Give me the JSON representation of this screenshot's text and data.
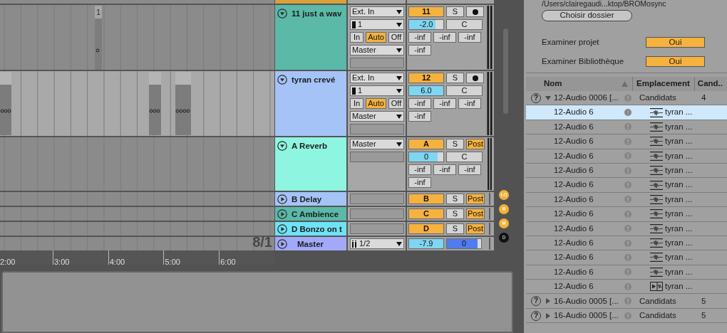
{
  "top_track": {
    "color": "#d7a23b"
  },
  "tracks": [
    {
      "kind": "audio",
      "name": "11 just a wav",
      "color": "#5bb9a8",
      "expanded": true,
      "lane": {
        "kind": "clip",
        "clip_label": "1"
      },
      "input": "Ext. In",
      "input_channel": "1",
      "monitor": [
        {
          "label": "In",
          "selected": false
        },
        {
          "label": "Auto",
          "selected": true
        },
        {
          "label": "Off",
          "selected": false
        }
      ],
      "output": "Master",
      "number": "11",
      "active": true,
      "solo": "S",
      "solo_on": false,
      "armed": false,
      "volume": {
        "text": "-2.0",
        "level": 0.78
      },
      "pan": "C",
      "sends": [
        "-inf",
        "-inf",
        "-inf",
        "-inf"
      ]
    },
    {
      "kind": "audio",
      "name": "tyran crevé",
      "color": "#a5c3f7",
      "expanded": true,
      "lane": {
        "kind": "waveform"
      },
      "input": "Ext. In",
      "input_channel": "1",
      "monitor": [
        {
          "label": "In",
          "selected": false
        },
        {
          "label": "Auto",
          "selected": true
        },
        {
          "label": "Off",
          "selected": false
        }
      ],
      "output": "Master",
      "number": "12",
      "active": true,
      "solo": "S",
      "solo_on": false,
      "armed": false,
      "volume": {
        "text": "6.0",
        "level": 1
      },
      "pan": "C",
      "sends": [
        "-inf",
        "-inf",
        "-inf",
        "-inf"
      ]
    },
    {
      "kind": "return",
      "name": "A Reverb",
      "color": "#8ef5e0",
      "expanded": true,
      "output": "Master",
      "letter": "A",
      "active": true,
      "solo": "S",
      "solo_on": false,
      "post": "Post",
      "post_on": true,
      "volume": {
        "text": "0",
        "level": 0.84
      },
      "pan": "C",
      "sends": [
        "-inf",
        "-inf",
        "-inf",
        "-inf"
      ]
    },
    {
      "kind": "return",
      "name": "B Delay",
      "color": "#a5c3f7",
      "expanded": false,
      "letter": "B",
      "active": true,
      "solo": "S",
      "solo_on": false,
      "post": "Post",
      "post_on": true
    },
    {
      "kind": "return",
      "name": "C Ambience",
      "color": "#5bb9a8",
      "expanded": false,
      "letter": "C",
      "active": true,
      "solo": "S",
      "solo_on": false,
      "post": "Post",
      "post_on": true
    },
    {
      "kind": "return",
      "name": "D Bonzo on t",
      "color": "#6fe3f5",
      "expanded": false,
      "letter": "D",
      "active": true,
      "solo": "S",
      "solo_on": false,
      "post": "Post",
      "post_on": true
    },
    {
      "kind": "master",
      "name": "Master",
      "color": "#a2a9f8",
      "expanded": false,
      "output": "1/2",
      "volume": {
        "text": "-7.9",
        "level": 1
      },
      "pan": {
        "text": "0",
        "level": 0.9
      },
      "position": "8/1"
    }
  ],
  "ruler": [
    "2:00",
    "3:00",
    "4:00",
    "5:00",
    "6:00"
  ],
  "view_buttons": [
    {
      "label": "I-O",
      "on": true
    },
    {
      "label": "R",
      "on": true
    },
    {
      "label": "M",
      "on": true
    },
    {
      "label": "D",
      "on": false
    }
  ],
  "browser": {
    "path": "/Users/clairegaudi...ktop/BROMosync",
    "choose_button": "Choisir dossier",
    "options": [
      {
        "label": "Examiner projet",
        "value": "Oui",
        "on": true
      },
      {
        "label": "Examiner Bibliothèque",
        "value": "Oui",
        "on": true
      }
    ],
    "table": {
      "columns": [
        {
          "label": "Nom",
          "sorted": true
        },
        {
          "label": "Emplacement",
          "sorted": false
        },
        {
          "label": "Cand..",
          "sorted": false
        }
      ],
      "rows": [
        {
          "help": "?",
          "name": "12-Audio 0006 [...",
          "location": "Candidats",
          "count": "4",
          "expanded": true,
          "children": [
            {
              "name": "12-Audio 6",
              "kind": "sample",
              "location": "tyran ...",
              "selected": true
            },
            {
              "name": "12-Audio 6",
              "kind": "sample",
              "location": "tyran ...",
              "selected": false
            },
            {
              "name": "12-Audio 6",
              "kind": "sample",
              "location": "tyran ...",
              "selected": false
            },
            {
              "name": "12-Audio 6",
              "kind": "sample",
              "location": "tyran ...",
              "selected": false
            },
            {
              "name": "12-Audio 6",
              "kind": "sample",
              "location": "tyran ...",
              "selected": false
            },
            {
              "name": "12-Audio 6",
              "kind": "sample",
              "location": "tyran ...",
              "selected": false
            },
            {
              "name": "12-Audio 6",
              "kind": "sample",
              "location": "tyran ...",
              "selected": false
            },
            {
              "name": "12-Audio 6",
              "kind": "sample",
              "location": "tyran ...",
              "selected": false
            },
            {
              "name": "12-Audio 6",
              "kind": "sample",
              "location": "tyran ...",
              "selected": false
            },
            {
              "name": "12-Audio 6",
              "kind": "sample",
              "location": "tyran ...",
              "selected": false
            },
            {
              "name": "12-Audio 6",
              "kind": "sample",
              "location": "tyran ...",
              "selected": false
            },
            {
              "name": "12-Audio 6",
              "kind": "sample",
              "location": "tyran ...",
              "selected": false
            },
            {
              "name": "12-Audio 6",
              "kind": "clip",
              "location": "tyran ...",
              "selected": false
            }
          ]
        },
        {
          "help": "?",
          "name": "16-Audio 0005 [...",
          "location": "Candidats",
          "count": "5",
          "expanded": false
        },
        {
          "help": "?",
          "name": "16-Audio 0005 [...",
          "location": "Candidats",
          "count": "5",
          "expanded": false
        }
      ]
    }
  }
}
